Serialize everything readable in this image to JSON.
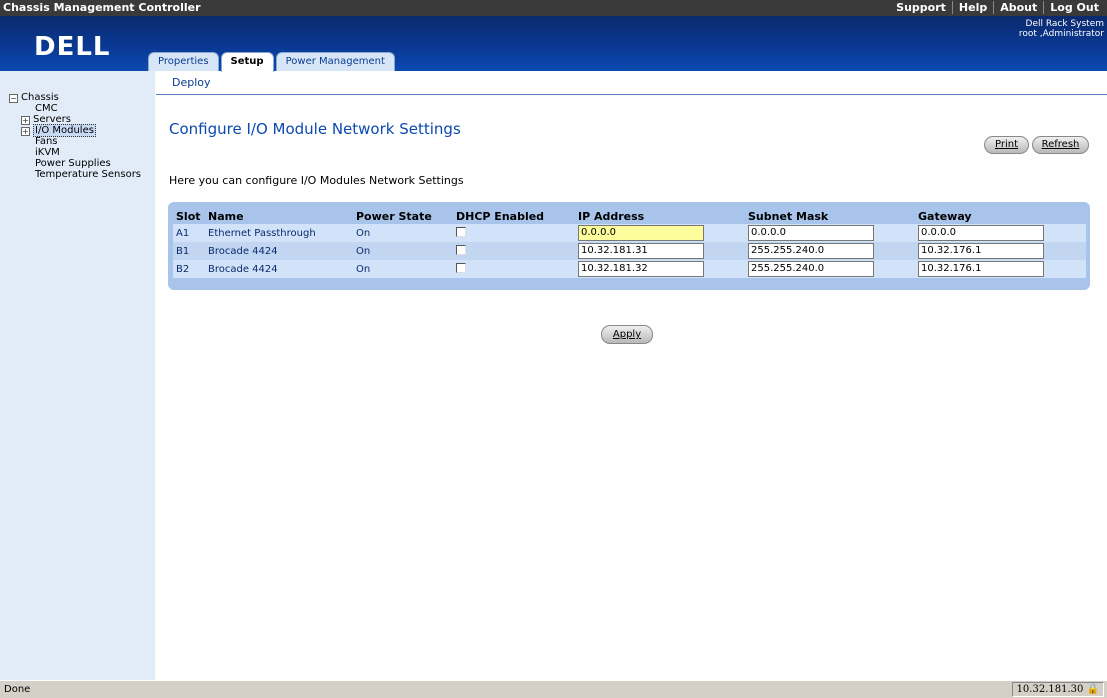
{
  "topbar": {
    "title": "Chassis Management Controller",
    "links": [
      "Support",
      "Help",
      "About",
      "Log Out"
    ]
  },
  "header": {
    "logo": "DELL",
    "system_name": "Dell Rack System",
    "user": "root ,Administrator"
  },
  "tabs": [
    {
      "label": "Properties",
      "active": false
    },
    {
      "label": "Setup",
      "active": true
    },
    {
      "label": "Power Management",
      "active": false
    }
  ],
  "subnav": {
    "deploy": "Deploy"
  },
  "tree": {
    "root": "Chassis",
    "cmc": "CMC",
    "servers": "Servers",
    "io_modules": "I/O Modules",
    "fans": "Fans",
    "ikvm": "iKVM",
    "power_supplies": "Power Supplies",
    "temperature_sensors": "Temperature Sensors"
  },
  "main": {
    "title": "Configure I/O Module Network Settings",
    "print": "Print",
    "refresh": "Refresh",
    "description": "Here you can configure I/O Modules Network Settings",
    "apply": "Apply"
  },
  "table": {
    "headers": [
      "Slot",
      "Name",
      "Power State",
      "DHCP Enabled",
      "IP Address",
      "Subnet Mask",
      "Gateway"
    ],
    "rows": [
      {
        "slot": "A1",
        "name": "Ethernet Passthrough",
        "power": "On",
        "dhcp": false,
        "ip": "0.0.0.0",
        "mask": "0.0.0.0",
        "gateway": "0.0.0.0"
      },
      {
        "slot": "B1",
        "name": "Brocade 4424",
        "power": "On",
        "dhcp": false,
        "ip": "10.32.181.31",
        "mask": "255.255.240.0",
        "gateway": "10.32.176.1"
      },
      {
        "slot": "B2",
        "name": "Brocade 4424",
        "power": "On",
        "dhcp": false,
        "ip": "10.32.181.32",
        "mask": "255.255.240.0",
        "gateway": "10.32.176.1"
      }
    ]
  },
  "statusbar": {
    "left": "Done",
    "right": "10.32.181.30"
  },
  "colors": {
    "header_blue": "#0a3a96",
    "nav_bg": "#e2ecf8",
    "table_bg": "#a9c4ea",
    "title_blue": "#0b4ab0"
  }
}
